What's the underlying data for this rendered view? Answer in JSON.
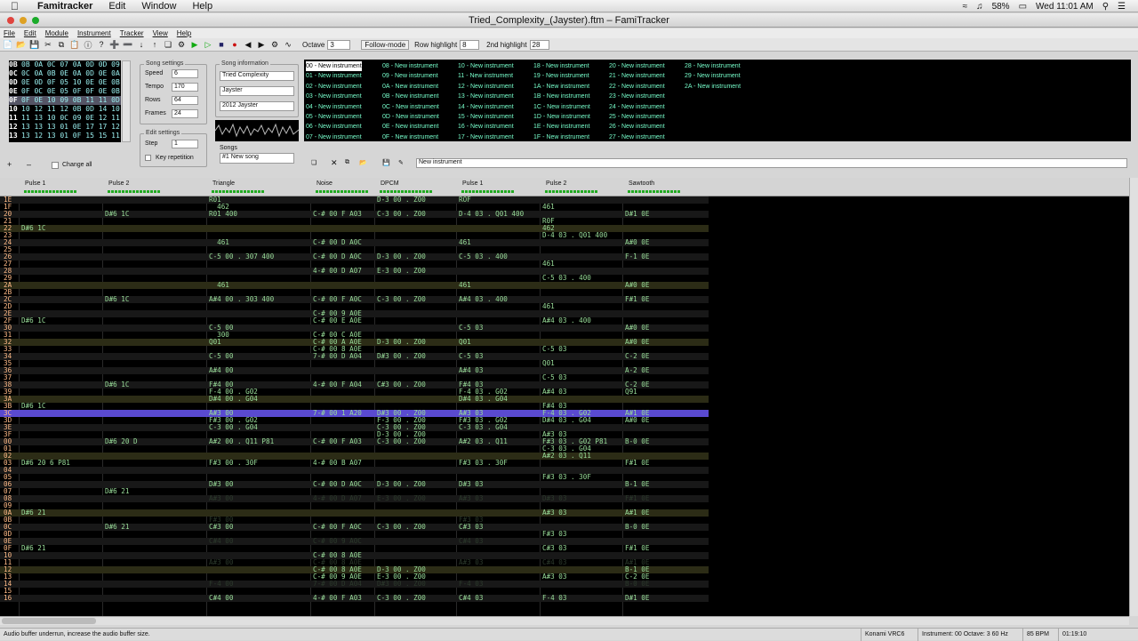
{
  "menubar": {
    "app": "Famitracker",
    "items": [
      "Edit",
      "Window",
      "Help"
    ],
    "battery": "58%",
    "clock": "Wed 11:01 AM"
  },
  "window": {
    "title": "Tried_Complexity_(Jayster).ftm – FamiTracker"
  },
  "appmenu": [
    "File",
    "Edit",
    "Module",
    "Instrument",
    "Tracker",
    "View",
    "Help"
  ],
  "toolbar": {
    "octave_label": "Octave",
    "octave": "3",
    "follow": "Follow-mode",
    "row_hl_label": "Row highlight",
    "row_hl": "8",
    "hl2_label": "2nd highlight",
    "hl2": "28"
  },
  "frames": [
    {
      "n": "0B",
      "v": "0B 0A 0C 07 0A 0D 0D 09"
    },
    {
      "n": "0C",
      "v": "0C 0A 0B 0E 0A 0D 0E 0A"
    },
    {
      "n": "0D",
      "v": "0E 0D 0F 05 10 0E 0E 0B"
    },
    {
      "n": "0E",
      "v": "0F 0C 0E 05 0F 0F 0E 0B"
    },
    {
      "n": "0F",
      "v": "0F 0E 10 09 0B 11 11 0D"
    },
    {
      "n": "10",
      "v": "10 12 11 12 0B 0D 14 10"
    },
    {
      "n": "11",
      "v": "11 13 10 0C 09 0E 12 11"
    },
    {
      "n": "12",
      "v": "13 13 13 01 0E 17 17 12"
    },
    {
      "n": "13",
      "v": "13 12 13 01 0F 15 15 11"
    }
  ],
  "frame_current": "0F",
  "song_settings": {
    "label": "Song settings",
    "speed_label": "Speed",
    "speed": "6",
    "tempo_label": "Tempo",
    "tempo": "170",
    "rows_label": "Rows",
    "rows": "64",
    "frames_label": "Frames",
    "frames": "24"
  },
  "edit_settings": {
    "label": "Edit settings",
    "step_label": "Step",
    "step": "1",
    "keyrep": "Key repetition",
    "change_all": "Change all"
  },
  "song_info": {
    "label": "Song information",
    "title": "Tried Complexity",
    "author": "Jayster",
    "copyright": "2012 Jayster"
  },
  "songs": {
    "label": "Songs",
    "selected": "#1 New song"
  },
  "instruments": [
    [
      "00 - New instrument",
      "01 - New instrument",
      "02 - New instrument",
      "03 - New instrument",
      "04 - New instrument",
      "05 - New instrument",
      "06 - New instrument",
      "07 - New instrument"
    ],
    [
      "08 - New instrument",
      "09 - New instrument",
      "0A - New instrument",
      "0B - New instrument",
      "0C - New instrument",
      "0D - New instrument",
      "0E - New instrument",
      "0F - New instrument"
    ],
    [
      "10 - New instrument",
      "11 - New instrument",
      "12 - New instrument",
      "13 - New instrument",
      "14 - New instrument",
      "15 - New instrument",
      "16 - New instrument",
      "17 - New instrument"
    ],
    [
      "18 - New instrument",
      "19 - New instrument",
      "1A - New instrument",
      "1B - New instrument",
      "1C - New instrument",
      "1D - New instrument",
      "1E - New instrument",
      "1F - New instrument"
    ],
    [
      "20 - New instrument",
      "21 - New instrument",
      "22 - New instrument",
      "23 - New instrument",
      "24 - New instrument",
      "25 - New instrument",
      "26 - New instrument",
      "27 - New instrument"
    ],
    [
      "28 - New instrument",
      "29 - New instrument",
      "2A - New instrument"
    ]
  ],
  "instr_name_field": "New instrument",
  "channels": [
    "Pulse 1",
    "Pulse 2",
    "Triangle",
    "Noise",
    "DPCM",
    "Pulse 1",
    "Pulse 2",
    "Sawtooth"
  ],
  "pattern_rows": [
    {
      "r": "1E",
      "c": [
        "",
        "",
        "R01",
        "",
        "D-3 00 . Z00",
        "ROF",
        "",
        ""
      ]
    },
    {
      "r": "1F",
      "c": [
        "",
        "",
        "  462",
        "",
        "",
        "",
        "461",
        ""
      ]
    },
    {
      "r": "20",
      "c": [
        "",
        "D#6 1C",
        "R01 400",
        "C-# 00 F A03",
        "C-3 00 . Z00",
        "D-4 03 . Q01 400",
        "",
        "D#1 0E"
      ]
    },
    {
      "r": "21",
      "c": [
        "",
        "",
        "",
        "",
        "",
        "",
        "R0F",
        ""
      ]
    },
    {
      "r": "22",
      "c": [
        "D#6 1C",
        "",
        "",
        "",
        "",
        "",
        "462",
        ""
      ]
    },
    {
      "r": "23",
      "c": [
        "",
        "",
        "",
        "",
        "",
        "",
        "D-4 03 . Q01 400",
        ""
      ]
    },
    {
      "r": "24",
      "c": [
        "",
        "",
        "  461",
        "C-# 00 D A0C",
        "",
        "461",
        "",
        "A#0 0E"
      ]
    },
    {
      "r": "25",
      "c": [
        "",
        "",
        "",
        "",
        "",
        "",
        "",
        ""
      ]
    },
    {
      "r": "26",
      "c": [
        "",
        "",
        "C-5 00 . 307 400",
        "C-# 00 D A0C",
        "D-3 00 . Z00",
        "C-5 03 . 400",
        "",
        "F-1 0E"
      ]
    },
    {
      "r": "27",
      "c": [
        "",
        "",
        "",
        "",
        "",
        "",
        "461",
        ""
      ]
    },
    {
      "r": "28",
      "c": [
        "",
        "",
        "",
        "4-# 00 D A07",
        "E-3 00 . Z00",
        "",
        "",
        ""
      ]
    },
    {
      "r": "29",
      "c": [
        "",
        "",
        "",
        "",
        "",
        "",
        "C-5 03 . 400",
        ""
      ]
    },
    {
      "r": "2A",
      "c": [
        "",
        "",
        "  461",
        "",
        "",
        "461",
        "",
        "A#0 0E"
      ]
    },
    {
      "r": "2B",
      "c": [
        "",
        "",
        "",
        "",
        "",
        "",
        "",
        ""
      ]
    },
    {
      "r": "2C",
      "c": [
        "",
        "D#6 1C",
        "A#4 00 . 303 400",
        "C-# 00 F A0C",
        "C-3 00 . Z00",
        "A#4 03 . 400",
        "",
        "F#1 0E"
      ]
    },
    {
      "r": "2D",
      "c": [
        "",
        "",
        "",
        "",
        "",
        "",
        "461",
        ""
      ]
    },
    {
      "r": "2E",
      "c": [
        "",
        "",
        "",
        "C-# 00 9 A0E",
        "",
        "",
        "",
        ""
      ]
    },
    {
      "r": "2F",
      "c": [
        "D#6 1C",
        "",
        "",
        "C-# 00 E A0E",
        "",
        "",
        "A#4 03 . 400",
        ""
      ]
    },
    {
      "r": "30",
      "c": [
        "",
        "",
        "C-5 00",
        "",
        "",
        "C-5 03",
        "",
        "A#0 0E"
      ]
    },
    {
      "r": "31",
      "c": [
        "",
        "",
        "  300",
        "C-# 00 C A0E",
        "",
        "",
        "",
        ""
      ]
    },
    {
      "r": "32",
      "c": [
        "",
        "",
        "Q01",
        "C-# 00 A A0E",
        "D-3 00 . Z00",
        "Q01",
        "",
        "A#0 0E"
      ]
    },
    {
      "r": "33",
      "c": [
        "",
        "",
        "",
        "C-# 00 8 A0E",
        "",
        "",
        "C-5 03",
        ""
      ]
    },
    {
      "r": "34",
      "c": [
        "",
        "",
        "C-5 00",
        "7-# 00 D A04",
        "D#3 00 . Z00",
        "C-5 03",
        "",
        "C-2 0E"
      ]
    },
    {
      "r": "35",
      "c": [
        "",
        "",
        "",
        "",
        "",
        "",
        "Q01",
        ""
      ]
    },
    {
      "r": "36",
      "c": [
        "",
        "",
        "A#4 00",
        "",
        "",
        "A#4 03",
        "",
        "A-2 0E"
      ]
    },
    {
      "r": "37",
      "c": [
        "",
        "",
        "",
        "",
        "",
        "",
        "C-5 03",
        ""
      ]
    },
    {
      "r": "38",
      "c": [
        "",
        "D#6 1C",
        "F#4 00",
        "4-# 00 F A04",
        "C#3 00 . Z00",
        "F#4 03",
        "",
        "C-2 0E"
      ]
    },
    {
      "r": "39",
      "c": [
        "",
        "",
        "F-4 00 . G02",
        "",
        "",
        "F-4 03 . G02",
        "A#4 03",
        "Q91"
      ]
    },
    {
      "r": "3A",
      "c": [
        "",
        "",
        "D#4 00 . G04",
        "",
        "",
        "D#4 03 . G04",
        "",
        ""
      ]
    },
    {
      "r": "3B",
      "c": [
        "D#6 1C",
        "",
        "",
        "",
        "",
        "",
        "F#4 03",
        ""
      ]
    },
    {
      "r": "3C",
      "c": [
        "",
        "",
        "A#3 00",
        "7-# 00 1 A20",
        "D#3 00 . Z00",
        "A#3 03",
        "F-4 03 . G02",
        "A#1 0E"
      ]
    },
    {
      "r": "3D",
      "c": [
        "",
        "",
        "F#3 00 . G02",
        "",
        "F-3 00 . Z00",
        "F#3 03 . G02",
        "D#4 03 . G04",
        "A#0 0E"
      ]
    },
    {
      "r": "3E",
      "c": [
        "",
        "",
        "C-3 00 . G04",
        "",
        "C-3 00 . Z00",
        "C-3 03 . G04",
        "",
        ""
      ]
    },
    {
      "r": "3F",
      "c": [
        "",
        "",
        "",
        "",
        "D-3 00 . Z00",
        "",
        "A#3 03",
        ""
      ]
    },
    {
      "r": "00",
      "c": [
        "",
        "D#6 20 D",
        "A#2 00 . Q11 P81",
        "C-# 00 F A03",
        "C-3 00 . Z00",
        "A#2 03 . Q11",
        "F#3 03 . G02 P81",
        "B-0 0E"
      ]
    },
    {
      "r": "01",
      "c": [
        "",
        "",
        "",
        "",
        "",
        "",
        "C-3 03 . G04",
        ""
      ]
    },
    {
      "r": "02",
      "c": [
        "",
        "",
        "",
        "",
        "",
        "",
        "A#2 03 . Q11",
        ""
      ]
    },
    {
      "r": "03",
      "c": [
        "D#6 20 6 P81",
        "",
        "F#3 00 . 30F",
        "4-# 00 B A07",
        "",
        "F#3 03 . 30F",
        "",
        "F#1 0E"
      ]
    },
    {
      "r": "04",
      "c": [
        "",
        "",
        "",
        "",
        "",
        "",
        "",
        ""
      ]
    },
    {
      "r": "05",
      "c": [
        "",
        "",
        "",
        "",
        "",
        "",
        "F#3 03 . 30F",
        ""
      ]
    },
    {
      "r": "06",
      "c": [
        "",
        "",
        "D#3 00",
        "C-# 00 D A0C",
        "D-3 00 . Z00",
        "D#3 03",
        "",
        "B-1 0E"
      ]
    },
    {
      "r": "07",
      "c": [
        "",
        "D#6 21",
        "",
        "",
        "",
        "",
        "",
        ""
      ]
    },
    {
      "r": "08",
      "c": [
        "",
        "",
        "A#3 00",
        "4-# 00 D A07",
        "E-3 00 . Z00",
        "A#3 03",
        "D#3 03",
        "F#1 0E"
      ]
    },
    {
      "r": "09",
      "c": [
        "",
        "",
        "",
        "",
        "",
        "",
        "",
        ""
      ]
    },
    {
      "r": "0A",
      "c": [
        "D#6 21",
        "",
        "",
        "",
        "",
        "",
        "A#3 03",
        "A#1 0E"
      ]
    },
    {
      "r": "0B",
      "c": [
        "",
        "",
        "F#3 00",
        "",
        "",
        "F#3 03",
        "",
        ""
      ]
    },
    {
      "r": "0C",
      "c": [
        "",
        "D#6 21",
        "C#3 00",
        "C-# 00 F A0C",
        "C-3 00 . Z00",
        "C#3 03",
        "",
        "B-0 0E"
      ]
    },
    {
      "r": "0D",
      "c": [
        "",
        "",
        "",
        "",
        "",
        "",
        "F#3 03",
        ""
      ]
    },
    {
      "r": "0E",
      "c": [
        "",
        "",
        "C#4 00",
        "C-# 00 9 A0C",
        "",
        "C#4 03",
        "",
        ""
      ]
    },
    {
      "r": "0F",
      "c": [
        "D#6 21",
        "",
        "",
        "",
        "",
        "",
        "C#3 03",
        "F#1 0E"
      ]
    },
    {
      "r": "10",
      "c": [
        "",
        "",
        "",
        "C-# 00 8 A0E",
        "",
        "",
        "",
        ""
      ]
    },
    {
      "r": "11",
      "c": [
        "",
        "",
        "A#3 00",
        "C-# 00 8 A0E",
        "",
        "A#3 03",
        "C#4 03",
        "A#1 0E"
      ]
    },
    {
      "r": "12",
      "c": [
        "",
        "",
        "",
        "C-# 00 8 A0E",
        "D-3 00 . Z00",
        "",
        "",
        "B-1 0E"
      ]
    },
    {
      "r": "13",
      "c": [
        "",
        "",
        "",
        "C-# 00 9 A0E",
        "E-3 00 . Z00",
        "",
        "A#3 03",
        "C-2 0E"
      ]
    },
    {
      "r": "14",
      "c": [
        "",
        "",
        "F-4 00",
        "7-# 00 D A04",
        "D#3 00 . Z00",
        "F-4 03",
        "",
        "B-0 0E"
      ]
    },
    {
      "r": "15",
      "c": [
        "",
        "",
        "",
        "",
        "",
        "",
        "",
        ""
      ]
    },
    {
      "r": "16",
      "c": [
        "",
        "",
        "C#4 00",
        "4-# 00 F A03",
        "C-3 00 . Z00",
        "C#4 03",
        "F-4 03",
        "D#1 0E"
      ]
    }
  ],
  "current_row": "3C",
  "status": {
    "message": "Audio buffer underrun, increase the audio buffer size.",
    "chip": "Konami VRC6",
    "info": "Instrument: 00  Octave: 3  60 Hz",
    "bpm": "85 BPM",
    "time": "01:19:10"
  }
}
